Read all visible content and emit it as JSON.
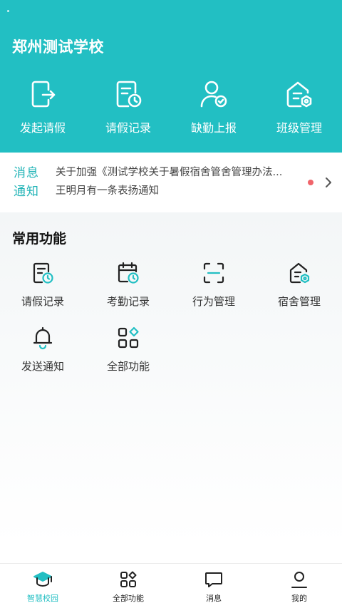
{
  "header": {
    "school_name": "郑州测试学校",
    "quick_actions": [
      {
        "label": "发起请假",
        "icon": "leave-request-icon"
      },
      {
        "label": "请假记录",
        "icon": "leave-record-icon"
      },
      {
        "label": "缺勤上报",
        "icon": "absence-report-icon"
      },
      {
        "label": "班级管理",
        "icon": "class-management-icon"
      }
    ]
  },
  "notice": {
    "tag_line1": "消息",
    "tag_line2": "通知",
    "items": [
      "关于加强《测试学校关于暑假宿舍管舍管理办法...",
      "王明月有一条表扬通知"
    ],
    "unread": true
  },
  "common": {
    "title": "常用功能",
    "items": [
      {
        "label": "请假记录",
        "icon": "leave-record-icon"
      },
      {
        "label": "考勤记录",
        "icon": "attendance-record-icon"
      },
      {
        "label": "行为管理",
        "icon": "behavior-scan-icon"
      },
      {
        "label": "宿舍管理",
        "icon": "dorm-management-icon"
      },
      {
        "label": "发送通知",
        "icon": "bell-icon"
      },
      {
        "label": "全部功能",
        "icon": "all-functions-icon"
      }
    ]
  },
  "tabbar": {
    "items": [
      {
        "label": "智慧校园",
        "icon": "graduation-cap-icon",
        "active": true
      },
      {
        "label": "全部功能",
        "icon": "grid-icon",
        "active": false
      },
      {
        "label": "消息",
        "icon": "chat-bubble-icon",
        "active": false
      },
      {
        "label": "我的",
        "icon": "user-icon",
        "active": false
      }
    ]
  },
  "colors": {
    "primary": "#22bfc3",
    "accent_dot": "#f0646a"
  }
}
